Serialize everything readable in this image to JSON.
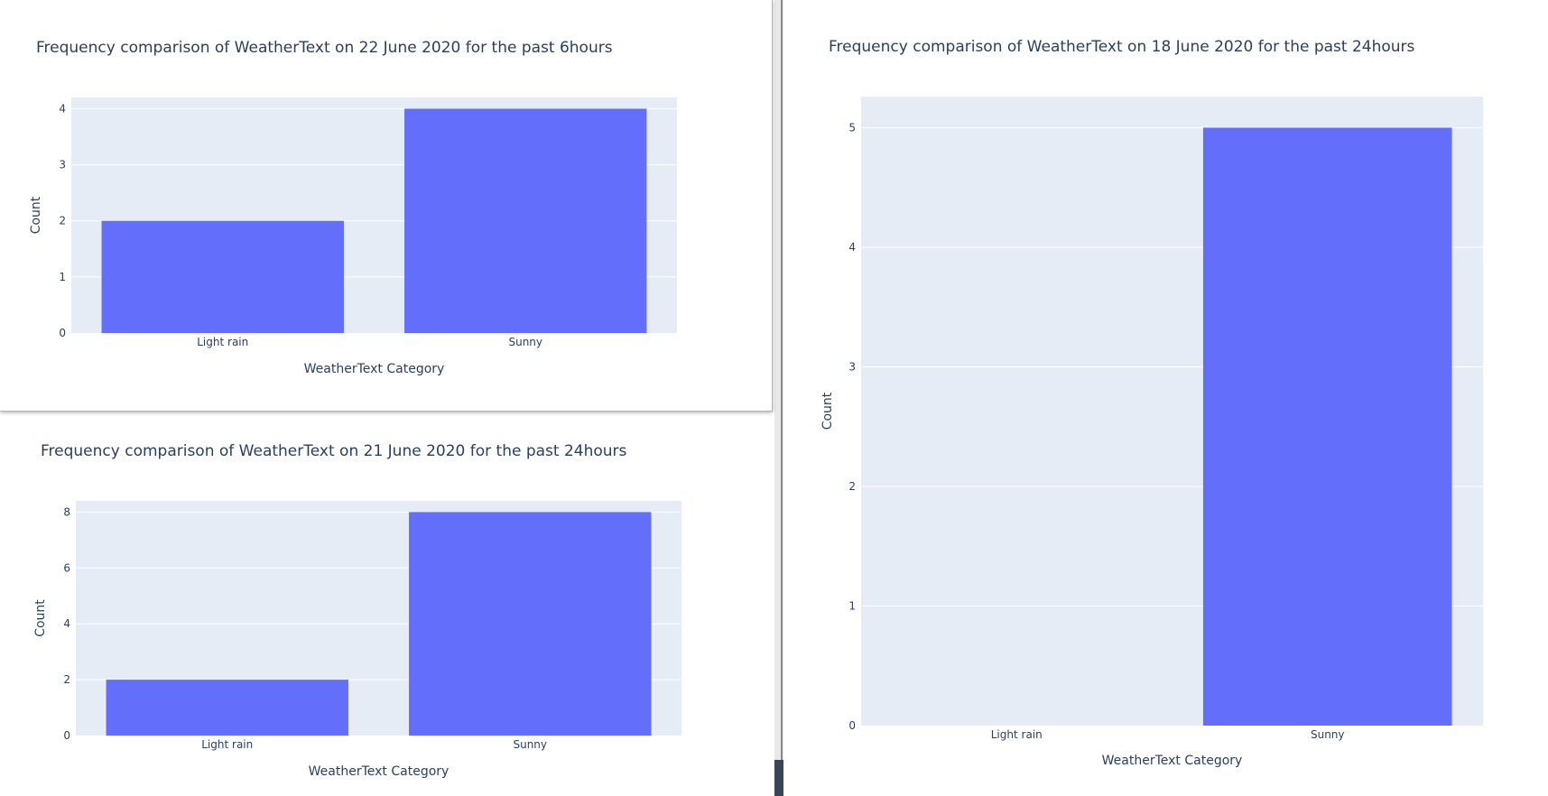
{
  "colors": {
    "bar": "#636efa",
    "plot_bg": "#e5ecf6",
    "grid": "#ffffff",
    "text": "#2a3f5f"
  },
  "chart_data": [
    {
      "type": "bar",
      "title": "Frequency comparison of WeatherText on 22 June 2020 for the past 6hours",
      "xlabel": "WeatherText Category",
      "ylabel": "Count",
      "categories": [
        "Light rain",
        "Sunny"
      ],
      "values": [
        2,
        4
      ],
      "ylim": [
        0,
        4.2
      ],
      "yticks": [
        0,
        1,
        2,
        3,
        4
      ],
      "grid": true
    },
    {
      "type": "bar",
      "title": "Frequency comparison of WeatherText on 21 June 2020 for the past 24hours",
      "xlabel": "WeatherText Category",
      "ylabel": "Count",
      "categories": [
        "Light rain",
        "Sunny"
      ],
      "values": [
        2,
        8
      ],
      "ylim": [
        0,
        8.4
      ],
      "yticks": [
        0,
        2,
        4,
        6,
        8
      ],
      "grid": true
    },
    {
      "type": "bar",
      "title": "Frequency comparison of WeatherText on 18 June 2020 for the past 24hours",
      "xlabel": "WeatherText Category",
      "ylabel": "Count",
      "categories": [
        "Light rain",
        "Sunny"
      ],
      "values": [
        0,
        5
      ],
      "ylim": [
        0,
        5.26
      ],
      "yticks": [
        0,
        1,
        2,
        3,
        4,
        5
      ],
      "grid": true
    }
  ]
}
